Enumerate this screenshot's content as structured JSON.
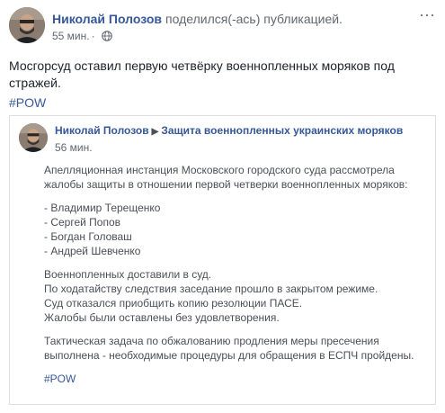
{
  "post": {
    "author": "Николай Полозов",
    "shared_text": "поделился(-ась) публикацией.",
    "time": "55 мин.",
    "privacy_icon": "globe-icon",
    "more_icon": "more-options-icon",
    "message": "Мосгорсуд оставил первую четвёрку военнопленных моряков под стражей.",
    "hashtag": "#POW"
  },
  "shared": {
    "author": "Николай Полозов",
    "arrow_icon": "arrow-right-icon",
    "group": "Защита военнопленных украинских моряков",
    "time": "56 мин.",
    "para1": [
      "Апелляционная инстанция Московского городского суда рассмотрела",
      "жалобы защиты в отношении первой четверки военнопленных моряков:"
    ],
    "names": [
      "- Владимир Терещенко",
      "- Сергей Попов",
      "- Богдан Головаш",
      "- Андрей Шевченко"
    ],
    "para3": [
      "Военнопленных доставили в суд.",
      "По ходатайству следствия заседание прошло в закрытом режиме.",
      "Суд отказался приобщить копию резолюции ПАСЕ.",
      "Жалобы были оставлены без удовлетворения."
    ],
    "para4": [
      "Тактическая задача по обжалованию продления меры пресечения",
      "выполнена - необходимые процедуры для обращения в ЕСПЧ пройдены."
    ],
    "hashtag": "#POW"
  },
  "colors": {
    "link": "#365899",
    "text": "#1d2129",
    "muted": "#616770",
    "border": "#dddfe2"
  }
}
